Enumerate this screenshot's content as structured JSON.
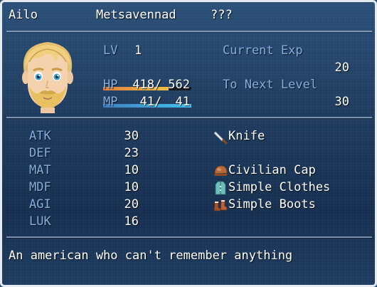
{
  "actor": {
    "name": "Ailo",
    "class": "Metsavennad",
    "nickname": "???",
    "level_label": "LV",
    "level": "1",
    "hp_label": "HP",
    "hp_current": "418",
    "hp_max": "562",
    "hp_ratio": 0.744,
    "mp_label": "MP",
    "mp_current": "41",
    "mp_max": "41",
    "mp_ratio": 1.0,
    "current_exp_label": "Current Exp",
    "current_exp": "20",
    "next_level_label": "To Next Level",
    "next_level": "30",
    "profile": "An american who can't remember anything"
  },
  "params": [
    {
      "label": "ATK",
      "value": "30"
    },
    {
      "label": "DEF",
      "value": "23"
    },
    {
      "label": "MAT",
      "value": "10"
    },
    {
      "label": "MDF",
      "value": "10"
    },
    {
      "label": "AGI",
      "value": "20"
    },
    {
      "label": "LUK",
      "value": "16"
    }
  ],
  "equipment": [
    {
      "name": "Knife",
      "icon": "knife-icon"
    },
    {
      "name": "Civilian Cap",
      "icon": "cap-icon"
    },
    {
      "name": "Simple Clothes",
      "icon": "clothes-icon"
    },
    {
      "name": "Simple Boots",
      "icon": "boots-icon"
    }
  ],
  "colors": {
    "system": "#84aee0",
    "hp_gauge_start": "#e08040",
    "hp_gauge_end": "#f0c040",
    "mp_gauge_start": "#4080c0",
    "mp_gauge_end": "#40c0f0",
    "window_border": "#e6ebf2"
  }
}
